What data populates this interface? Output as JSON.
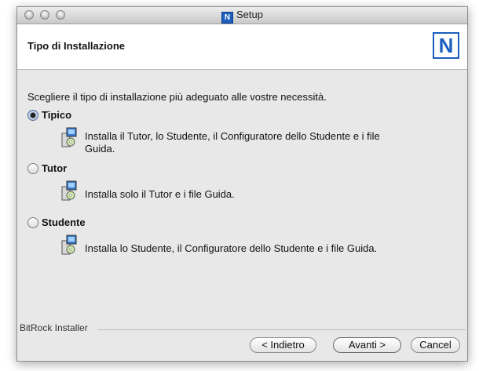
{
  "window": {
    "title": "Setup"
  },
  "header": {
    "title": "Tipo di Installazione",
    "logo_letter": "N"
  },
  "instruction": "Scegliere il tipo di installazione più adeguato alle vostre necessità.",
  "options": [
    {
      "label": "Tipico",
      "selected": true,
      "description_lines": [
        "Installa il Tutor, lo Studente, il Configuratore dello Studente e i file",
        "Guida."
      ],
      "icon": "installer-package-icon"
    },
    {
      "label": "Tutor",
      "selected": false,
      "description_lines": [
        "Installa solo il Tutor e i file Guida."
      ],
      "icon": "installer-package-icon"
    },
    {
      "label": "Studente",
      "selected": false,
      "description_lines": [
        "Installa lo Studente, il Configuratore dello Studente e i file Guida."
      ],
      "icon": "installer-package-icon"
    }
  ],
  "footer": {
    "brand": "BitRock Installer",
    "back_label": "< Indietro",
    "next_label": "Avanti >",
    "cancel_label": "Cancel"
  }
}
